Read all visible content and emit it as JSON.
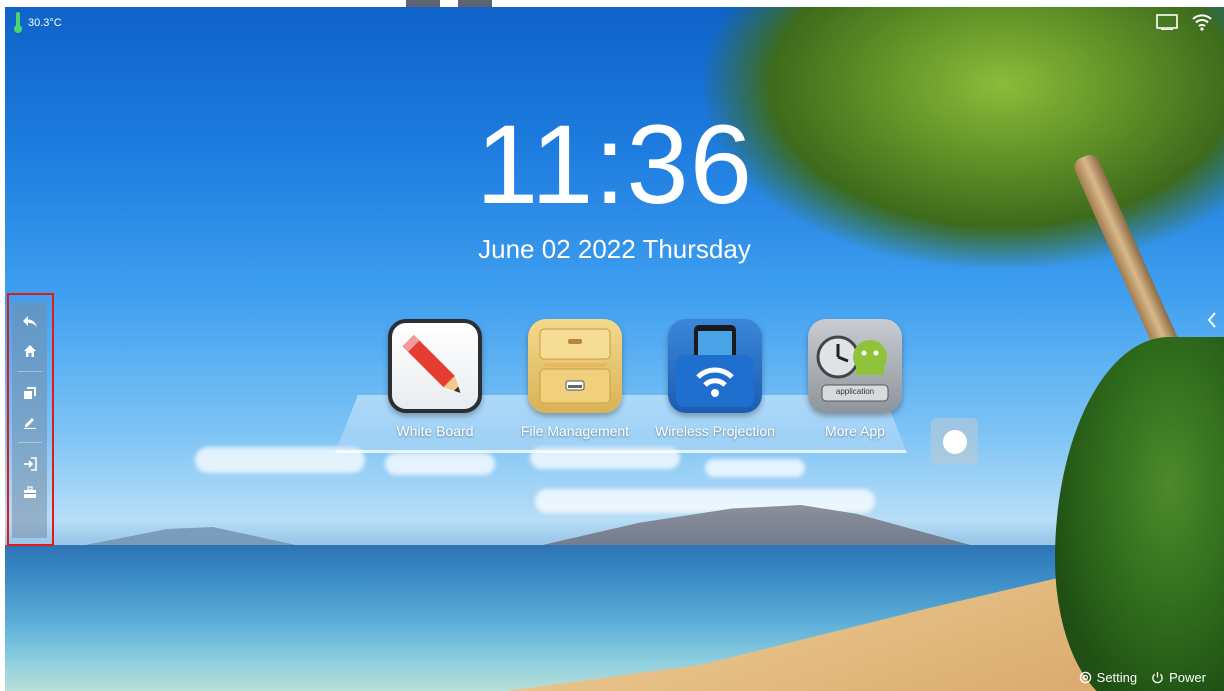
{
  "status": {
    "temperature": "30.3°C"
  },
  "clock": {
    "time": "11:36",
    "date": "June 02 2022 Thursday"
  },
  "apps": [
    {
      "label": "White Board",
      "icon": "pencil-icon"
    },
    {
      "label": "File Management",
      "icon": "file-cabinet-icon"
    },
    {
      "label": "Wireless Projection",
      "icon": "wireless-projection-icon"
    },
    {
      "label": "More App",
      "icon": "more-app-icon"
    }
  ],
  "app_icon_text": {
    "more_app_tag": "application"
  },
  "toolbar": {
    "items": [
      "back-icon",
      "home-icon",
      "windows-icon",
      "annotate-icon",
      "input-source-icon",
      "toolbox-icon"
    ]
  },
  "bottom": {
    "setting_label": "Setting",
    "power_label": "Power"
  },
  "colors": {
    "thermometer": "#4ad66d",
    "highlight_box": "#e01b1b"
  }
}
